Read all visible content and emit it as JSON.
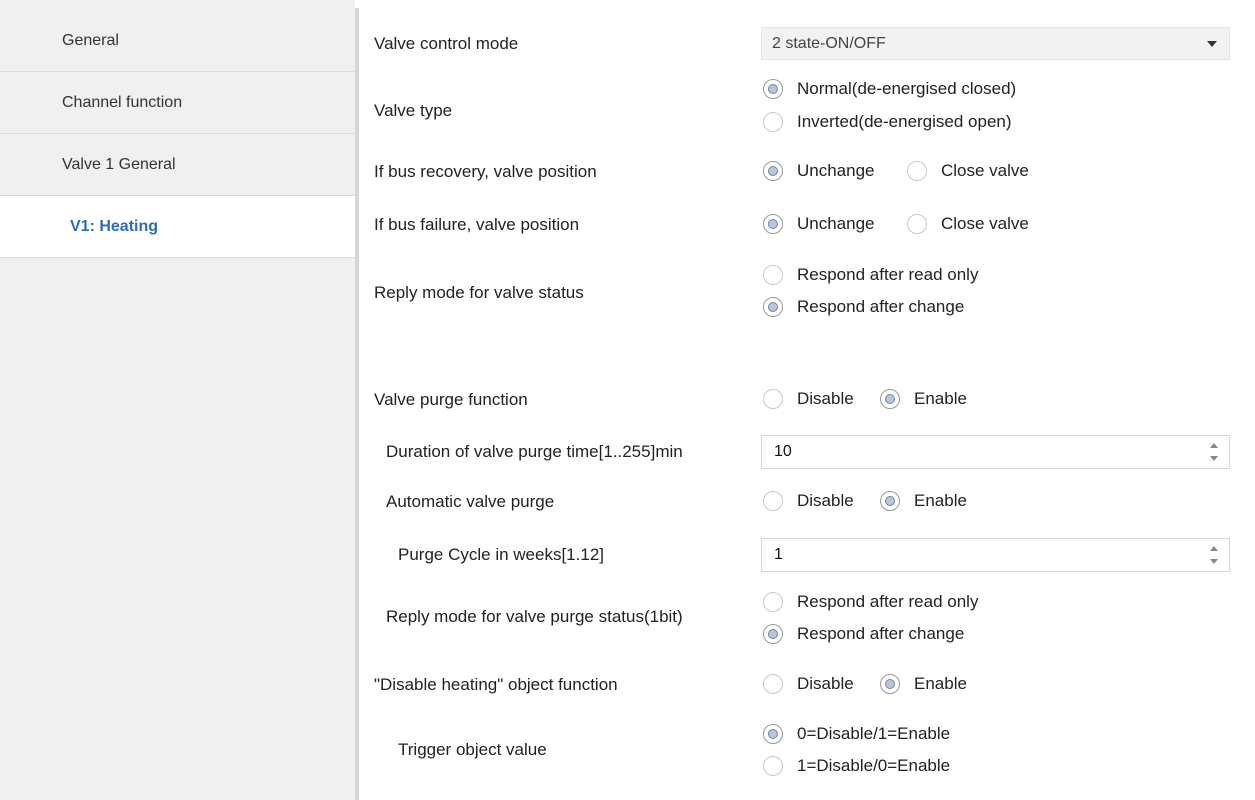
{
  "sidebar": {
    "items": [
      {
        "label": "General",
        "active": false
      },
      {
        "label": "Channel function",
        "active": false
      },
      {
        "label": "Valve 1 General",
        "active": false
      },
      {
        "label": "V1: Heating",
        "active": true
      }
    ]
  },
  "colors": {
    "active_nav_text": "#2a6db5",
    "sidebar_bg": "#f0f0f0",
    "radio_selected_fill": "#b7c6dd"
  },
  "params": {
    "valve_control_mode": {
      "label": "Valve control mode",
      "value": "2 state-ON/OFF"
    },
    "valve_type": {
      "label": "Valve type",
      "options": [
        "Normal(de-energised closed)",
        "Inverted(de-energised open)"
      ],
      "selected": 0
    },
    "bus_recovery": {
      "label": "If bus recovery, valve position",
      "options": [
        "Unchange",
        "Close valve"
      ],
      "selected": 0
    },
    "bus_failure": {
      "label": "If bus failure, valve position",
      "options": [
        "Unchange",
        "Close valve"
      ],
      "selected": 0
    },
    "reply_mode_status": {
      "label": "Reply mode for valve status",
      "options": [
        "Respond after read only",
        "Respond after change"
      ],
      "selected": 1
    },
    "valve_purge_function": {
      "label": "Valve purge function",
      "options": [
        "Disable",
        "Enable"
      ],
      "selected": 1
    },
    "purge_duration": {
      "label": "Duration of valve purge time[1..255]min",
      "value": "10"
    },
    "automatic_purge": {
      "label": "Automatic valve purge",
      "options": [
        "Disable",
        "Enable"
      ],
      "selected": 1
    },
    "purge_cycle": {
      "label": "Purge Cycle in weeks[1.12]",
      "value": "1"
    },
    "reply_mode_purge": {
      "label": "Reply mode for valve purge status(1bit)",
      "options": [
        "Respond after read only",
        "Respond after change"
      ],
      "selected": 1
    },
    "disable_heating_object": {
      "label": "\"Disable heating\" object function",
      "options": [
        "Disable",
        "Enable"
      ],
      "selected": 1
    },
    "trigger_value": {
      "label": "Trigger object value",
      "options": [
        "0=Disable/1=Enable",
        "1=Disable/0=Enable"
      ],
      "selected": 0
    }
  }
}
